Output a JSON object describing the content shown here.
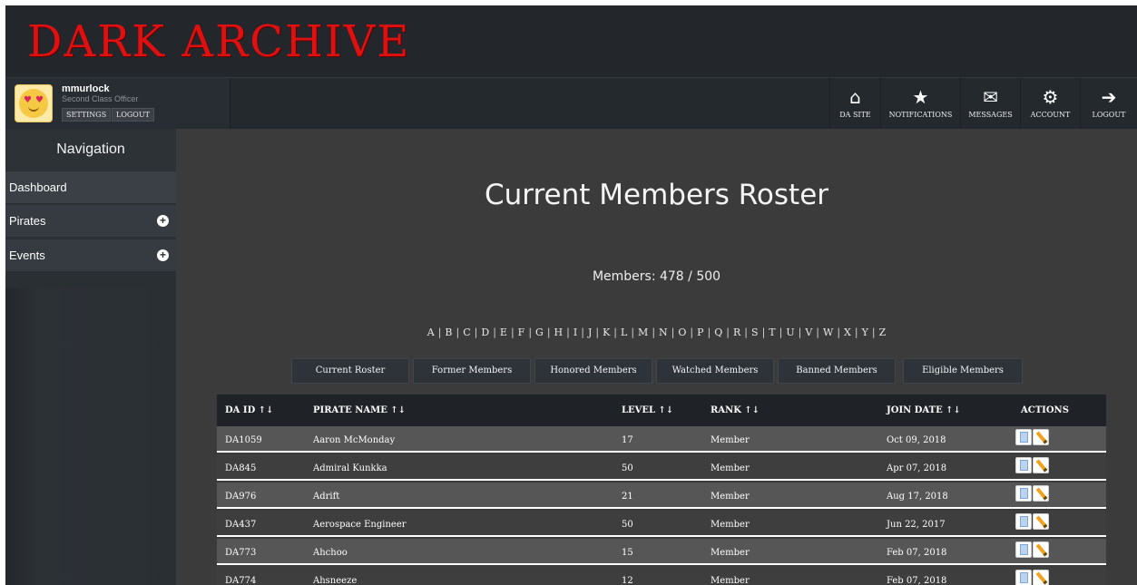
{
  "app": {
    "logo_text": "DARK ARCHIVE"
  },
  "user": {
    "name": "mmurlock",
    "rank": "Second Class Officer",
    "settings_label": "SETTINGS",
    "logout_label": "LOGOUT"
  },
  "topnav": {
    "da_site": {
      "label": "DA SITE",
      "icon": "home-icon"
    },
    "notifications": {
      "label": "NOTIFICATIONS",
      "icon": "star-icon"
    },
    "messages": {
      "label": "MESSAGES",
      "icon": "envelope-icon"
    },
    "account": {
      "label": "ACCOUNT",
      "icon": "gear-icon"
    },
    "logout": {
      "label": "LOGOUT",
      "icon": "user-logout-icon"
    }
  },
  "sidebar": {
    "title": "Navigation",
    "items": [
      {
        "label": "Dashboard"
      },
      {
        "label": "Pirates",
        "expandable": true
      },
      {
        "label": "Events",
        "expandable": true
      }
    ]
  },
  "main": {
    "title": "Current Members Roster",
    "member_count": "Members: 478 / 500",
    "alphabet": [
      "A",
      "B",
      "C",
      "D",
      "E",
      "F",
      "G",
      "H",
      "I",
      "J",
      "K",
      "L",
      "M",
      "N",
      "O",
      "P",
      "Q",
      "R",
      "S",
      "T",
      "U",
      "V",
      "W",
      "X",
      "Y",
      "Z"
    ],
    "filters": [
      "Current Roster",
      "Former Members",
      "Honored Members",
      "Watched Members",
      "Banned Members",
      "Eligible Members"
    ]
  },
  "table": {
    "headers": {
      "id": "DA ID ↑↓",
      "name": "PIRATE NAME ↑↓",
      "level": "LEVEL ↑↓",
      "rank": "RANK ↑↓",
      "join": "JOIN DATE ↑↓",
      "actions": "ACTIONS"
    },
    "rows": [
      {
        "id": "DA1059",
        "name": "Aaron McMonday",
        "level": "17",
        "rank": "Member",
        "join": "Oct 09, 2018"
      },
      {
        "id": "DA845",
        "name": "Admiral Kunkka",
        "level": "50",
        "rank": "Member",
        "join": "Apr 07, 2018"
      },
      {
        "id": "DA976",
        "name": "Adrift",
        "level": "21",
        "rank": "Member",
        "join": "Aug 17, 2018"
      },
      {
        "id": "DA437",
        "name": "Aerospace Engineer",
        "level": "50",
        "rank": "Member",
        "join": "Jun 22, 2017"
      },
      {
        "id": "DA773",
        "name": "Ahchoo",
        "level": "15",
        "rank": "Member",
        "join": "Feb 07, 2018"
      },
      {
        "id": "DA774",
        "name": "Ahsneeze",
        "level": "12",
        "rank": "Member",
        "join": "Feb 07, 2018"
      }
    ]
  },
  "colors": {
    "logo": "#e01010",
    "header_bg": "#23272b",
    "main_bg": "#3b3b3b",
    "row_light": "#565656",
    "row_dark": "#3e3e3e"
  }
}
